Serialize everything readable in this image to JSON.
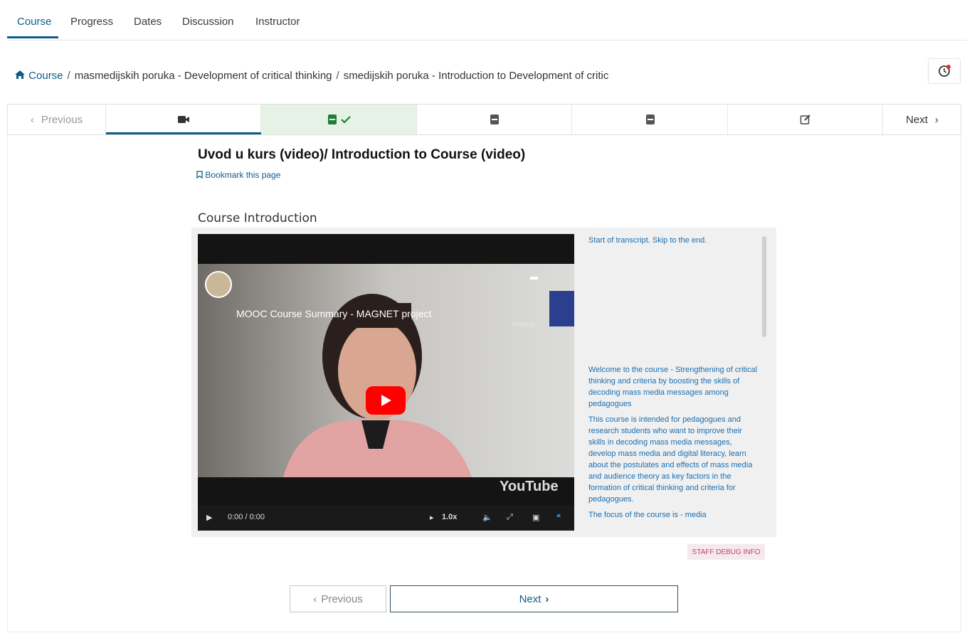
{
  "tabs": [
    {
      "label": "Course"
    },
    {
      "label": "Progress"
    },
    {
      "label": "Dates"
    },
    {
      "label": "Discussion"
    },
    {
      "label": "Instructor"
    }
  ],
  "breadcrumb": {
    "home": "Course",
    "item1": "masmedijskih poruka - Development of critical thinking",
    "item2": "smedijskih poruka - Introduction to Development of critic"
  },
  "sequence": {
    "prev": "Previous",
    "next": "Next",
    "units": [
      "video",
      "problem-completed",
      "problem",
      "problem",
      "edit"
    ]
  },
  "unit": {
    "title": "Uvod u kurs (video)/ Introduction to Course (video)",
    "bookmark": "Bookmark this page",
    "section": "Course Introduction"
  },
  "video": {
    "title": "MOOC Course Summary - MAGNET project",
    "share": "Kopiraj...",
    "time": "0:00 / 0:00",
    "speed": "1.0x",
    "brand": "YouTube"
  },
  "transcript": {
    "start": "Start of transcript. Skip to the end.",
    "lines": [
      "Welcome to the course - Strengthening of critical thinking and criteria by boosting the skills of decoding mass media messages among pedagogues",
      "This course is intended for pedagogues and research students who want to improve their skills in decoding mass media messages, develop mass media and digital literacy, learn about the postulates and effects of mass media and audience theory as key factors in the formation of critical thinking and criteria for pedagogues.",
      "The focus of the course is - media"
    ]
  },
  "debug": "STAFF DEBUG INFO",
  "footer_nav": {
    "prev": "Previous",
    "next": "Next"
  },
  "colors": {
    "accent": "#0f5c88",
    "completed_bg": "#e6f2e6",
    "completed_icon": "#1e7e34"
  }
}
